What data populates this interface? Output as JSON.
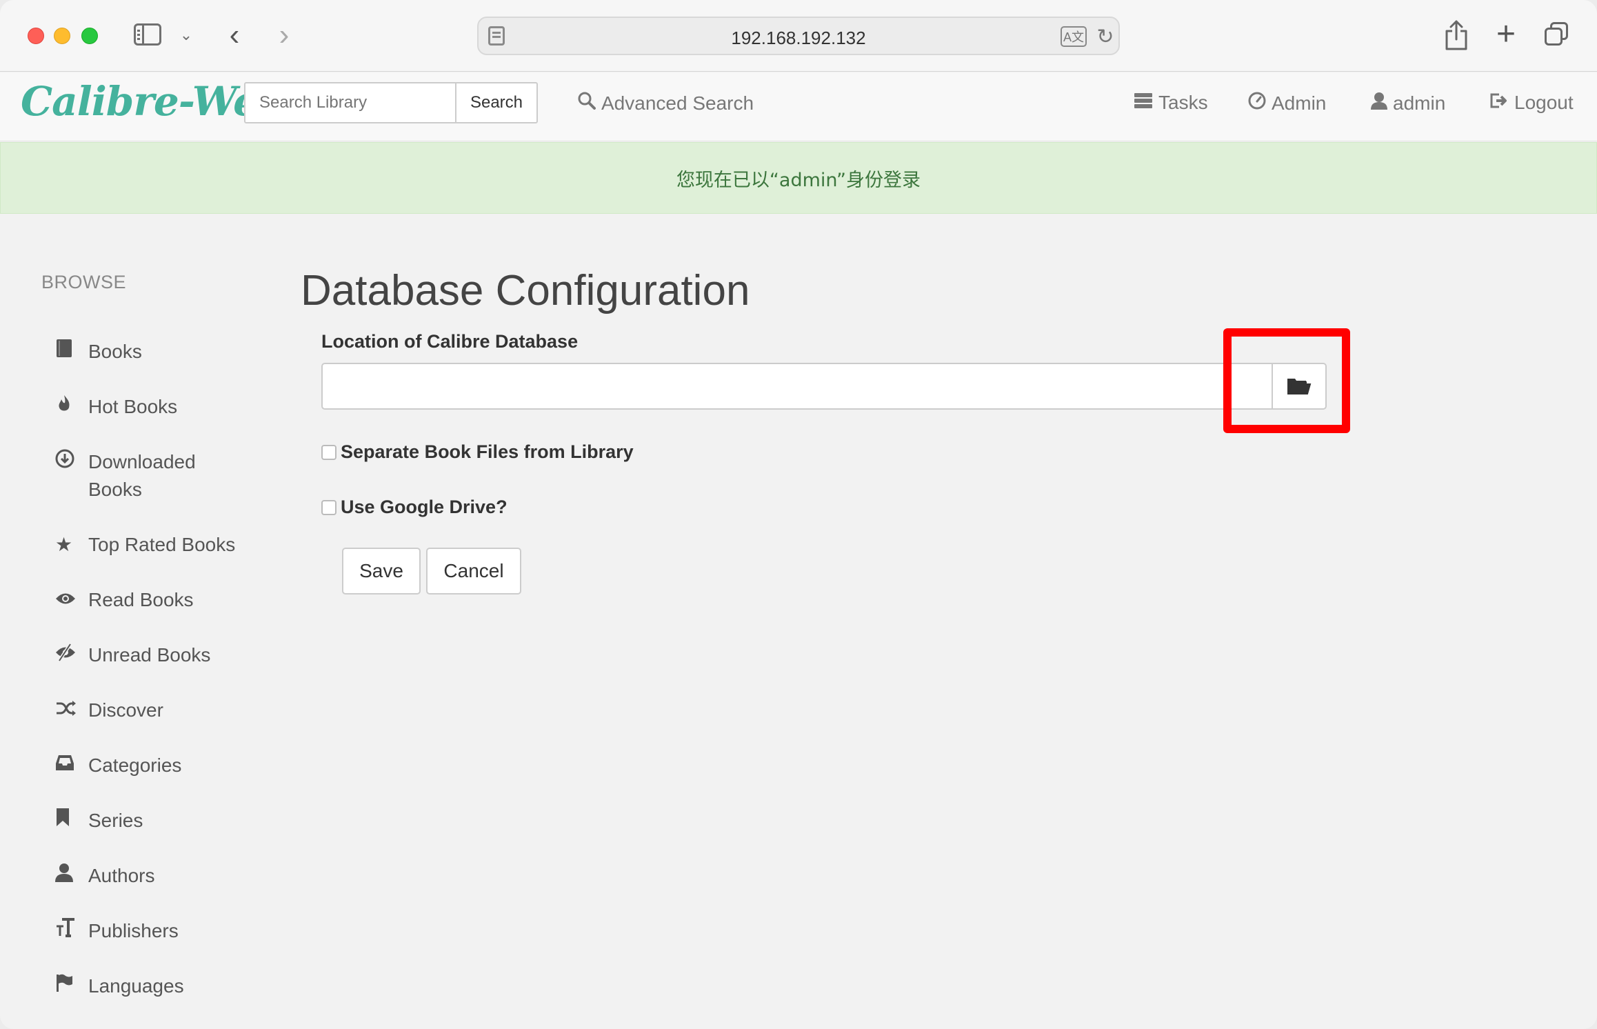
{
  "browser": {
    "url": "192.168.192.132",
    "translate_glyph": "A文"
  },
  "navbar": {
    "brand": "Calibre-Web",
    "search_placeholder": "Search Library",
    "search_button": "Search",
    "advanced_search": "Advanced Search",
    "tasks": "Tasks",
    "admin": "Admin",
    "user": "admin",
    "logout": "Logout"
  },
  "alert": {
    "message": "您现在已以“admin”身份登录"
  },
  "sidebar": {
    "heading": "BROWSE",
    "items": [
      {
        "label": "Books",
        "icon": "book-icon"
      },
      {
        "label": "Hot Books",
        "icon": "fire-icon"
      },
      {
        "label": "Downloaded Books",
        "icon": "download-icon"
      },
      {
        "label": "Top Rated Books",
        "icon": "star-icon"
      },
      {
        "label": "Read Books",
        "icon": "eye-icon"
      },
      {
        "label": "Unread Books",
        "icon": "eye-slash-icon"
      },
      {
        "label": "Discover",
        "icon": "shuffle-icon"
      },
      {
        "label": "Categories",
        "icon": "inbox-icon"
      },
      {
        "label": "Series",
        "icon": "bookmark-icon"
      },
      {
        "label": "Authors",
        "icon": "user-icon"
      },
      {
        "label": "Publishers",
        "icon": "text-size-icon"
      },
      {
        "label": "Languages",
        "icon": "flag-icon"
      }
    ]
  },
  "main": {
    "title": "Database Configuration",
    "location_label": "Location of Calibre Database",
    "location_value": "",
    "separate_files_label": "Separate Book Files from Library",
    "separate_files_checked": false,
    "google_drive_label": "Use Google Drive?",
    "google_drive_checked": false,
    "save_label": "Save",
    "cancel_label": "Cancel"
  },
  "colors": {
    "brand": "#45b29d",
    "alert_bg": "#dff0d8",
    "alert_text": "#3c763d",
    "highlight": "#ff0000"
  }
}
